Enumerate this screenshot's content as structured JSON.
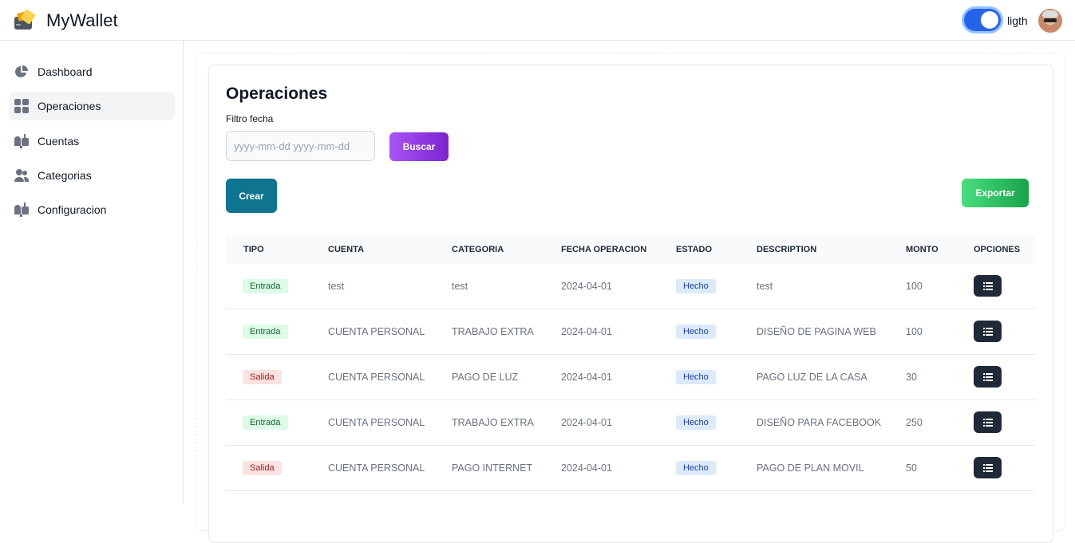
{
  "app": {
    "title": "MyWallet",
    "theme_label": "ligth",
    "theme_toggle_on": true
  },
  "sidebar": {
    "items": [
      {
        "label": "Dashboard",
        "icon": "pie-chart-icon"
      },
      {
        "label": "Operaciones",
        "icon": "grid-icon",
        "active": true
      },
      {
        "label": "Cuentas",
        "icon": "mailbox-icon"
      },
      {
        "label": "Categorias",
        "icon": "users-icon"
      },
      {
        "label": "Configuracion",
        "icon": "mailbox-icon"
      }
    ]
  },
  "main": {
    "title": "Operaciones",
    "filter_label": "Filtro fecha",
    "date_placeholder": "yyyy-mm-dd  yyyy-mm-dd",
    "search_label": "Buscar",
    "create_label": "Crear",
    "export_label": "Exportar",
    "colors": {
      "entrada_bg": "#dcfce7",
      "salida_bg": "#fee2e2",
      "hecho_bg": "#dbeafe",
      "crear": "#0e7490",
      "buscar": "#9333ea",
      "exportar": "#22c55e"
    },
    "table": {
      "headers": [
        "TIPO",
        "CUENTA",
        "CATEGORIA",
        "FECHA OPERACION",
        "ESTADO",
        "DESCRIPTION",
        "MONTO",
        "OPCIONES"
      ],
      "rows": [
        {
          "tipo": "Entrada",
          "cuenta": "test",
          "categoria": "test",
          "fecha": "2024-04-01",
          "estado": "Hecho",
          "descripcion": "test",
          "monto": "100"
        },
        {
          "tipo": "Entrada",
          "cuenta": "CUENTA PERSONAL",
          "categoria": "TRABAJO EXTRA",
          "fecha": "2024-04-01",
          "estado": "Hecho",
          "descripcion": "DISEÑO DE PAGINA WEB",
          "monto": "100"
        },
        {
          "tipo": "Salida",
          "cuenta": "CUENTA PERSONAL",
          "categoria": "PAGO DE LUZ",
          "fecha": "2024-04-01",
          "estado": "Hecho",
          "descripcion": "PAGO LUZ DE LA CASA",
          "monto": "30"
        },
        {
          "tipo": "Entrada",
          "cuenta": "CUENTA PERSONAL",
          "categoria": "TRABAJO EXTRA",
          "fecha": "2024-04-01",
          "estado": "Hecho",
          "descripcion": "DISEÑO PARA FACEBOOK",
          "monto": "250"
        },
        {
          "tipo": "Salida",
          "cuenta": "CUENTA PERSONAL",
          "categoria": "PAGO INTERNET",
          "fecha": "2024-04-01",
          "estado": "Hecho",
          "descripcion": "PAGO DE PLAN MOVIL",
          "monto": "50"
        }
      ]
    }
  }
}
